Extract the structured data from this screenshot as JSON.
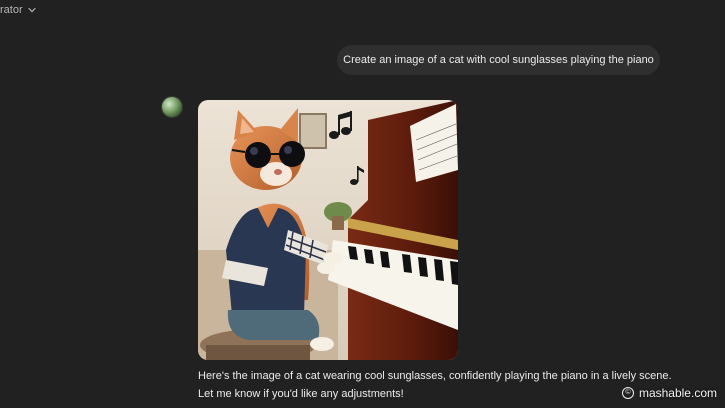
{
  "header": {
    "model_label": "rator"
  },
  "conversation": {
    "user_message": "Create an image of a cat with cool sunglasses playing the piano",
    "assistant": {
      "avatar_icon": "gizmo-avatar",
      "image_icon": "cat-with-sunglasses-playing-piano-image",
      "response_lines": [
        "Here's the image of a cat wearing cool sunglasses, confidently playing the piano in a lively scene.",
        "Let me know if you'd like any adjustments!"
      ]
    }
  },
  "watermark": {
    "symbol": "©",
    "text": "mashable.com"
  },
  "colors": {
    "background": "#212121",
    "bubble": "#2f2f2f",
    "text": "#ececec"
  }
}
